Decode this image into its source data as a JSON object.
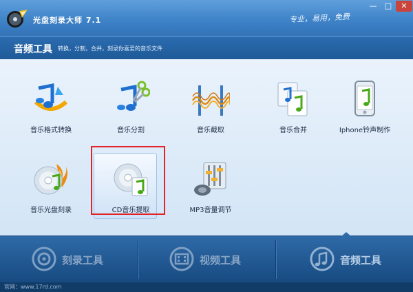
{
  "window": {
    "title": "光盘刻录大师 7.1",
    "slogan": "专业，易用，免费",
    "min_label": "—",
    "max_label": "□",
    "close_label": "✕"
  },
  "section": {
    "title": "音频工具",
    "description": "转换，分割，合并，刻录你喜爱的音乐文件"
  },
  "tools": [
    {
      "label": "音乐格式转换",
      "icon": "music-convert-icon"
    },
    {
      "label": "音乐分割",
      "icon": "music-split-icon"
    },
    {
      "label": "音乐截取",
      "icon": "music-cut-icon"
    },
    {
      "label": "音乐合并",
      "icon": "music-merge-icon"
    },
    {
      "label": "Iphone铃声制作",
      "icon": "iphone-ringtone-icon"
    },
    {
      "label": "音乐光盘刻录",
      "icon": "music-disc-burn-icon"
    },
    {
      "label": "CD音乐提取",
      "icon": "cd-extract-icon",
      "selected": true
    },
    {
      "label": "MP3音量调节",
      "icon": "mp3-volume-icon"
    }
  ],
  "nav": [
    {
      "label": "刻录工具",
      "icon": "disc-icon"
    },
    {
      "label": "视频工具",
      "icon": "film-icon"
    },
    {
      "label": "音频工具",
      "icon": "music-note-icon",
      "active": true
    }
  ],
  "footer": {
    "text": "官网：www.17rd.com"
  },
  "colors": {
    "accent": "#2a64a0",
    "highlight": "#e2232a",
    "text": "#1d2c44"
  }
}
